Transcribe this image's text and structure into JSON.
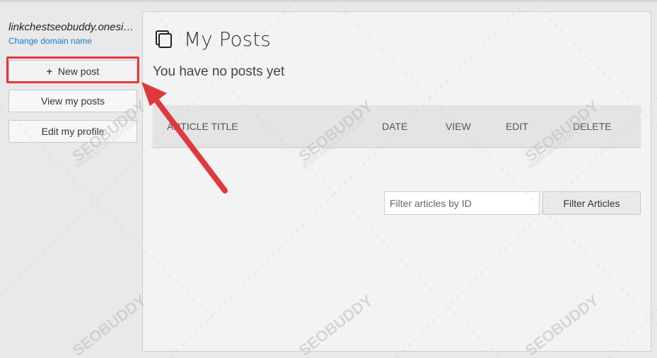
{
  "sidebar": {
    "domain": "linkchestseobuddy.onesignal.com",
    "change_domain": "Change domain name",
    "buttons": [
      {
        "label": "New post",
        "icon": "plus-icon"
      },
      {
        "label": "View my posts"
      },
      {
        "label": "Edit my profile"
      }
    ]
  },
  "main": {
    "title": "My Posts",
    "title_icon": "posts-stack-icon",
    "empty_message": "You have no posts yet",
    "table": {
      "columns": [
        "ARTICLE TITLE",
        "DATE",
        "VIEW",
        "EDIT",
        "DELETE"
      ]
    },
    "filter": {
      "placeholder": "Filter articles by ID",
      "value": "",
      "button_label": "Filter Articles"
    }
  },
  "annotation": {
    "highlight_color": "#e0383e",
    "arrow_color": "#e0383e",
    "watermark": "SEOBUDDY",
    "watermark_url": "WWW.SEOBUDDY.COM"
  }
}
